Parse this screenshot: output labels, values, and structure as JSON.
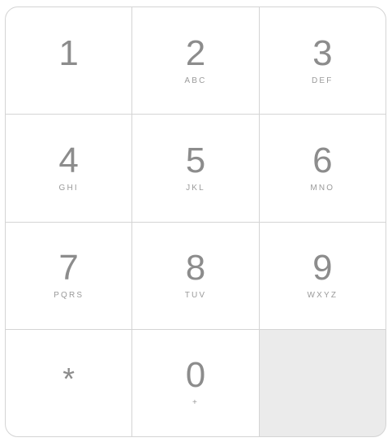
{
  "keypad": {
    "keys": [
      {
        "digit": "1",
        "letters": ""
      },
      {
        "digit": "2",
        "letters": "ABC"
      },
      {
        "digit": "3",
        "letters": "DEF"
      },
      {
        "digit": "4",
        "letters": "GHI"
      },
      {
        "digit": "5",
        "letters": "JKL"
      },
      {
        "digit": "6",
        "letters": "MNO"
      },
      {
        "digit": "7",
        "letters": "PQRS"
      },
      {
        "digit": "8",
        "letters": "TUV"
      },
      {
        "digit": "9",
        "letters": "WXYZ"
      },
      {
        "digit": "*",
        "letters": ""
      },
      {
        "digit": "0",
        "letters": "+"
      }
    ]
  }
}
